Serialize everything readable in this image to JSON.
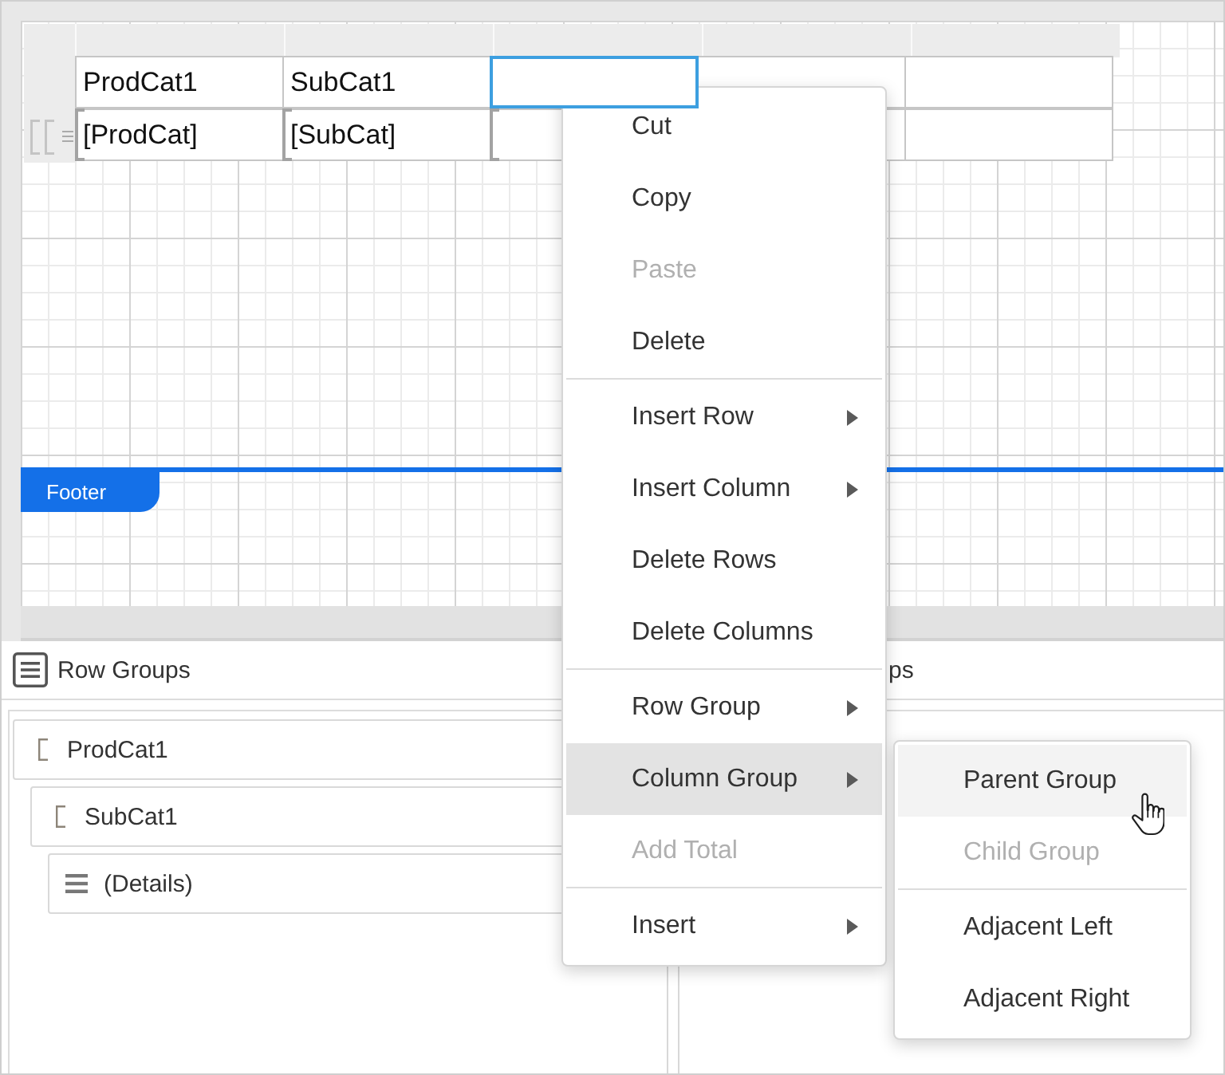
{
  "report_table": {
    "rows": [
      {
        "kind": "header",
        "cells": [
          {
            "text": "ProdCat1",
            "selected": false,
            "group_bracket": false
          },
          {
            "text": "SubCat1",
            "selected": false,
            "group_bracket": false
          },
          {
            "selected": true,
            "group_bracket": false
          },
          {
            "selected": false,
            "group_bracket": false
          },
          {
            "selected": false,
            "group_bracket": false
          }
        ]
      },
      {
        "kind": "details",
        "cells": [
          {
            "text": "[ProdCat]",
            "selected": false,
            "group_bracket": true
          },
          {
            "text": "[SubCat]",
            "selected": false,
            "group_bracket": true
          },
          {
            "selected": false,
            "group_bracket": true
          },
          {
            "selected": false,
            "group_bracket": false
          },
          {
            "selected": false,
            "group_bracket": false
          }
        ]
      }
    ]
  },
  "footer_band": {
    "label": "Footer"
  },
  "row_groups": {
    "title": "Row Groups",
    "groups": [
      {
        "kind": "group",
        "label": "ProdCat1",
        "children": [
          {
            "kind": "group",
            "label": "SubCat1",
            "children": [
              {
                "kind": "details",
                "label": "(Details)"
              }
            ]
          }
        ]
      }
    ]
  },
  "column_groups": {
    "title": "ps"
  },
  "context_menu": {
    "items": [
      {
        "kind": "command",
        "label": "Cut",
        "disabled": false,
        "highlighted": false
      },
      {
        "kind": "command",
        "label": "Copy",
        "disabled": false,
        "highlighted": false
      },
      {
        "kind": "command",
        "label": "Paste",
        "disabled": true,
        "highlighted": false
      },
      {
        "kind": "command",
        "label": "Delete",
        "disabled": false,
        "highlighted": false
      },
      {
        "kind": "separator"
      },
      {
        "kind": "submenu",
        "label": "Insert Row",
        "disabled": false,
        "highlighted": false
      },
      {
        "kind": "submenu",
        "label": "Insert Column",
        "disabled": false,
        "highlighted": false
      },
      {
        "kind": "command",
        "label": "Delete Rows",
        "disabled": false,
        "highlighted": false
      },
      {
        "kind": "command",
        "label": "Delete Columns",
        "disabled": false,
        "highlighted": false
      },
      {
        "kind": "separator"
      },
      {
        "kind": "submenu",
        "label": "Row Group",
        "disabled": false,
        "highlighted": false
      },
      {
        "kind": "submenu",
        "label": "Column Group",
        "disabled": false,
        "highlighted": true
      },
      {
        "kind": "command",
        "label": "Add Total",
        "disabled": true,
        "highlighted": false
      },
      {
        "kind": "separator"
      },
      {
        "kind": "submenu",
        "label": "Insert",
        "disabled": false,
        "highlighted": false
      }
    ]
  },
  "submenu": {
    "items": [
      {
        "kind": "command",
        "label": "Parent Group",
        "disabled": false,
        "highlighted": true
      },
      {
        "kind": "command",
        "label": "Child Group",
        "disabled": true,
        "highlighted": false
      },
      {
        "kind": "separator"
      },
      {
        "kind": "command",
        "label": "Adjacent Left",
        "disabled": false,
        "highlighted": false
      },
      {
        "kind": "command",
        "label": "Adjacent Right",
        "disabled": false,
        "highlighted": false
      }
    ]
  }
}
